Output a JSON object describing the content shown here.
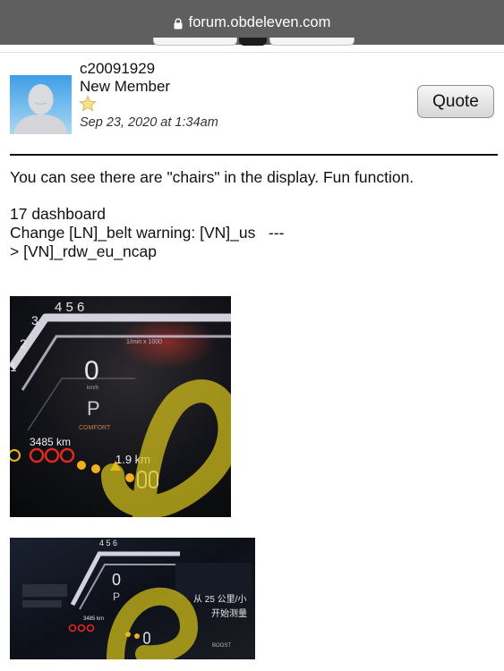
{
  "browser": {
    "url": "forum.obdeleven.com",
    "icons": [
      "lock-icon"
    ]
  },
  "post": {
    "author": {
      "username": "c20091929",
      "role": "New Member",
      "rank_icon": "star-icon",
      "avatar": "default-avatar"
    },
    "timestamp": "Sep 23, 2020 at 1:34am",
    "quote_label": "Quote",
    "body": {
      "line1": "You can see there are \"chairs\" in the display. Fun function.",
      "line2": "17 dashboard",
      "line3": "Change [LN]_belt warning: [VN]_us   ---",
      "line4": "> [VN]_rdw_eu_ncap"
    },
    "images": [
      {
        "name": "dashboard-photo-1",
        "texts": {
          "gear_numbers": "4 5 6",
          "low_gears": [
            "3",
            "2",
            "1"
          ],
          "rpm_label": "1/min x 1000",
          "speed": "0",
          "speed_unit": "km/h",
          "gear": "P",
          "mode": "COMFORT",
          "range": "3485 km",
          "trip": "1.9 km"
        }
      },
      {
        "name": "dashboard-photo-2",
        "texts": {
          "gear_numbers": "4 5 6",
          "speed": "0",
          "gear": "P",
          "chinese_line1": "从 25 公里/小",
          "chinese_line2": "开始测量",
          "range": "3485 km",
          "boost": "BOOST"
        }
      }
    ]
  },
  "colors": {
    "topbar": "#5f5f5f",
    "highlighter": "#d6c21b",
    "dashboard_bg": "#0b0d12"
  }
}
